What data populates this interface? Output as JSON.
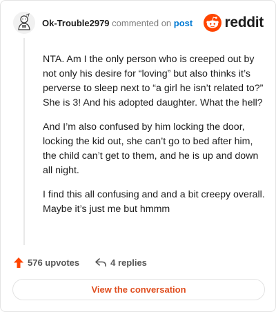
{
  "header": {
    "username": "Ok-Trouble2979",
    "action_text": "commented on",
    "link_text": "post"
  },
  "brand": {
    "name": "reddit",
    "icon": "reddit-alien-icon",
    "color": "#ff4500"
  },
  "comment": {
    "paragraphs": [
      "NTA. Am I the only person who is creeped out by not only his desire for “loving” but also thinks it’s perverse to sleep next to “a girl he isn’t related to?” She is 3! And his adopted daughter. What the hell?",
      "And I’m also confused by him locking the door, locking the kid out, she can’t go to bed after him, the child can’t get to them, and he is up and down all night.",
      "I find this all confusing and and a bit creepy overall. Maybe it’s just me but hmmm"
    ]
  },
  "footer": {
    "upvotes_label": "576 upvotes",
    "replies_label": "4 replies",
    "upvote_icon": "upvote-arrow-icon",
    "reply_icon": "reply-arrow-icon",
    "upvote_color": "#ff4500"
  },
  "cta": {
    "label": "View the conversation",
    "color": "#e04e1f"
  }
}
